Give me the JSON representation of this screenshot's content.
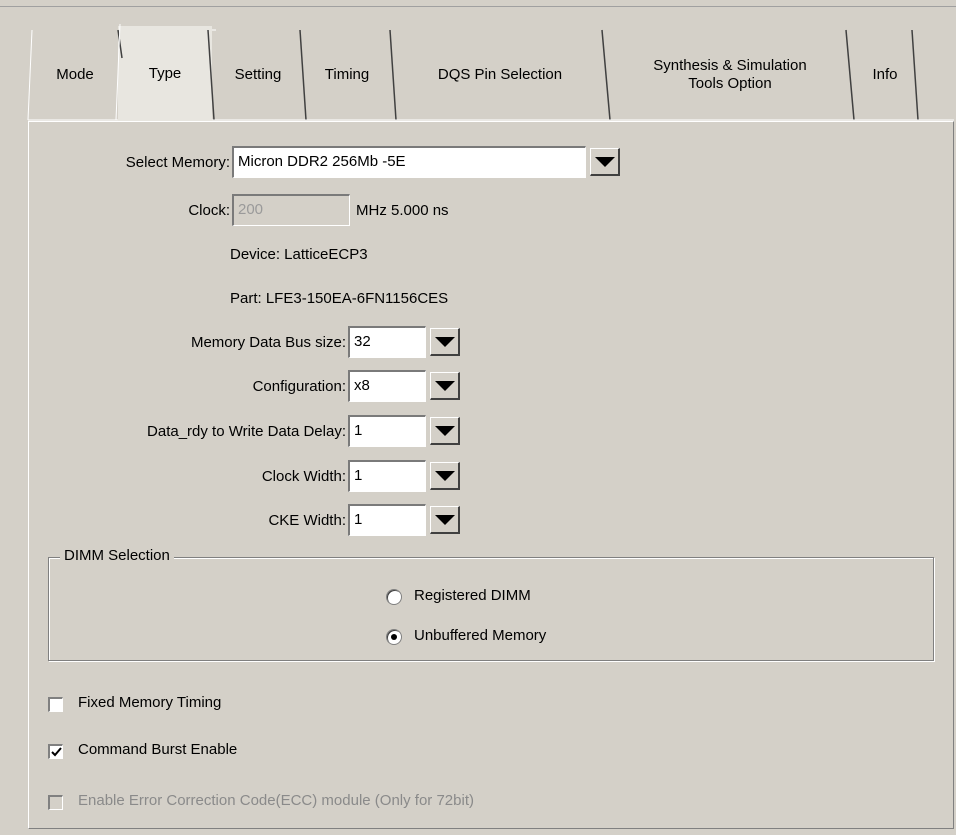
{
  "tabs": [
    {
      "label": "Mode"
    },
    {
      "label": "Type"
    },
    {
      "label": "Setting"
    },
    {
      "label": "Timing"
    },
    {
      "label": "DQS Pin Selection"
    },
    {
      "label": "Synthesis & Simulation Tools Option",
      "line1": "Synthesis & Simulation",
      "line2": "Tools Option"
    },
    {
      "label": "Info"
    }
  ],
  "selected_tab": "Type",
  "form": {
    "select_memory": {
      "label": "Select Memory:",
      "value": "Micron DDR2 256Mb -5E"
    },
    "clock": {
      "label": "Clock:",
      "value": "200",
      "unit_text": "MHz 5.000 ns"
    },
    "device": "Device: LatticeECP3",
    "part": "Part: LFE3-150EA-6FN1156CES",
    "bus_size": {
      "label": "Memory Data Bus size:",
      "value": "32"
    },
    "configuration": {
      "label": "Configuration:",
      "value": "x8"
    },
    "data_rdy_delay": {
      "label": "Data_rdy to Write Data Delay:",
      "value": "1"
    },
    "clock_width": {
      "label": "Clock Width:",
      "value": "1"
    },
    "cke_width": {
      "label": "CKE Width:",
      "value": "1"
    }
  },
  "dimm": {
    "legend": "DIMM Selection",
    "options": [
      {
        "label": "Registered DIMM",
        "selected": false
      },
      {
        "label": "Unbuffered Memory",
        "selected": true
      }
    ]
  },
  "checkboxes": [
    {
      "label": "Fixed Memory Timing",
      "checked": false,
      "disabled": false
    },
    {
      "label": "Command Burst Enable",
      "checked": true,
      "disabled": false
    },
    {
      "label": "Enable Error Correction Code(ECC) module (Only for 72bit)",
      "checked": false,
      "disabled": true
    }
  ]
}
